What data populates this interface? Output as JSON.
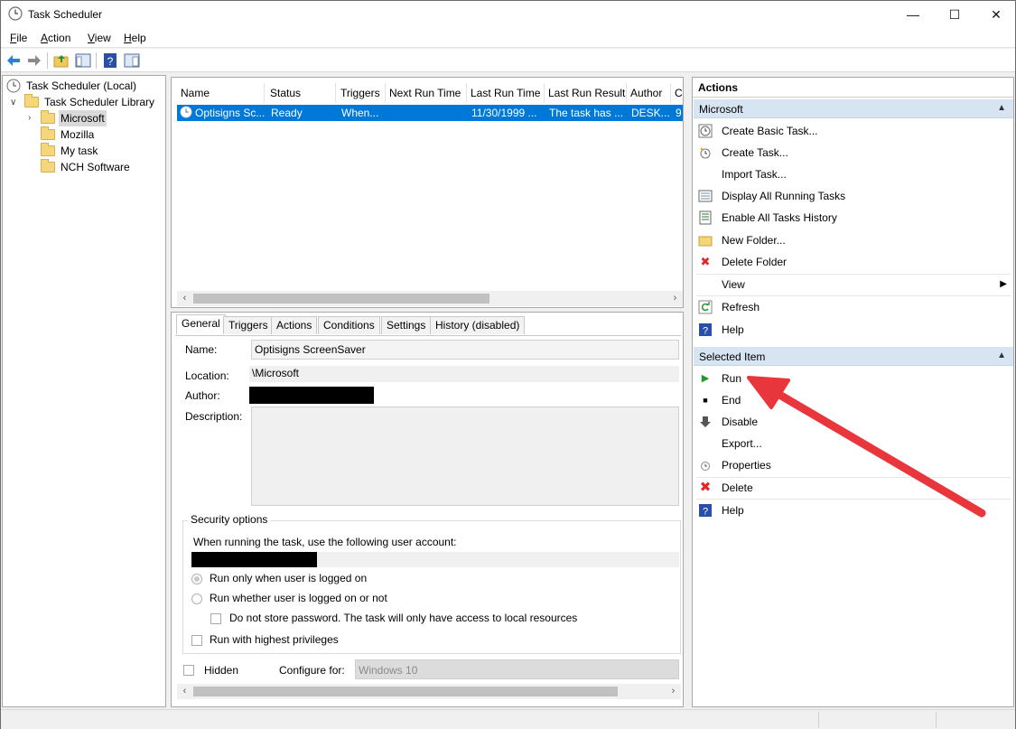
{
  "window": {
    "title": "Task Scheduler",
    "minimize": "—",
    "maximize": "☐",
    "close": "✕"
  },
  "menu": [
    {
      "label": "File",
      "key": "F",
      "rest": "ile"
    },
    {
      "label": "Action",
      "key": "A",
      "rest": "ction"
    },
    {
      "label": "View",
      "key": "V",
      "rest": "iew"
    },
    {
      "label": "Help",
      "key": "H",
      "rest": "elp"
    }
  ],
  "toolbar": {
    "icons": [
      "back-arrow-icon",
      "forward-arrow-icon",
      "up-folder-icon",
      "show-hide-tree-icon",
      "help-icon",
      "show-hide-action-pane-icon"
    ]
  },
  "tree": {
    "root": "Task Scheduler (Local)",
    "library": "Task Scheduler Library",
    "folders": [
      "Microsoft",
      "Mozilla",
      "My task",
      "NCH Software"
    ]
  },
  "tasklist": {
    "columns": [
      "Name",
      "Status",
      "Triggers",
      "Next Run Time",
      "Last Run Time",
      "Last Run Result",
      "Author",
      "C"
    ],
    "rows": [
      {
        "name": "Optisigns Sc...",
        "status": "Ready",
        "triggers": "When...",
        "next_run": "",
        "last_run": "11/30/1999 ...",
        "last_result": "The task has ...",
        "author": "DESK...",
        "created": "9"
      }
    ]
  },
  "detail": {
    "tabs": [
      "General",
      "Triggers",
      "Actions",
      "Conditions",
      "Settings",
      "History (disabled)"
    ],
    "name_label": "Name:",
    "name_value": "Optisigns ScreenSaver",
    "location_label": "Location:",
    "location_value": "\\Microsoft",
    "author_label": "Author:",
    "description_label": "Description:",
    "security_title": "Security options",
    "account_prompt": "When running the task, use the following user account:",
    "radio_logged_on": "Run only when user is logged on",
    "radio_whether": "Run whether user is logged on or not",
    "no_store_pwd": "Do not store password.  The task will only have access to local resources",
    "highest_priv": "Run with highest privileges",
    "hidden_label": "Hidden",
    "configure_label": "Configure for:",
    "configure_value": "Windows 10"
  },
  "actions": {
    "title": "Actions",
    "section1": "Microsoft",
    "items1": [
      {
        "label": "Create Basic Task...",
        "icon": "create-basic-task-icon"
      },
      {
        "label": "Create Task...",
        "icon": "create-task-icon"
      },
      {
        "label": "Import Task...",
        "icon": ""
      },
      {
        "label": "Display All Running Tasks",
        "icon": "running-tasks-icon"
      },
      {
        "label": "Enable All Tasks History",
        "icon": "tasks-history-icon"
      },
      {
        "label": "New Folder...",
        "icon": "new-folder-icon"
      },
      {
        "label": "Delete Folder",
        "icon": "delete-icon"
      },
      {
        "label": "View",
        "icon": ""
      },
      {
        "label": "Refresh",
        "icon": "refresh-icon"
      },
      {
        "label": "Help",
        "icon": "help-icon"
      }
    ],
    "section2": "Selected Item",
    "items2": [
      {
        "label": "Run",
        "icon": "run-icon"
      },
      {
        "label": "End",
        "icon": "end-icon"
      },
      {
        "label": "Disable",
        "icon": "disable-icon"
      },
      {
        "label": "Export...",
        "icon": ""
      },
      {
        "label": "Properties",
        "icon": "properties-icon"
      },
      {
        "label": "Delete",
        "icon": "delete-icon"
      },
      {
        "label": "Help",
        "icon": "help-icon"
      }
    ]
  },
  "colors": {
    "selection": "#0078d7",
    "section_header": "#d7e4f2",
    "annotation_arrow": "#e8363c"
  }
}
